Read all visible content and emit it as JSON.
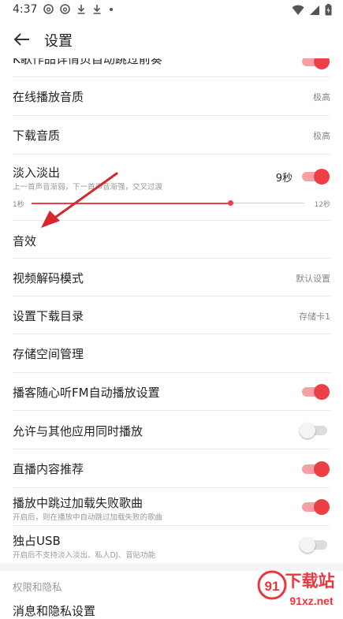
{
  "status": {
    "time": "4:37"
  },
  "header": {
    "title": "设置"
  },
  "rows": {
    "skip_preview": {
      "label": "K歌作品详情页自动跳过前奏"
    },
    "online_quality": {
      "label": "在线播放音质",
      "value": "极高"
    },
    "download_quality": {
      "label": "下载音质",
      "value": "极高"
    },
    "fade": {
      "label": "淡入淡出",
      "subtitle": "上一首声音渐弱，下一首声音渐强，交叉过渡",
      "value": "9秒",
      "slider_min": "1秒",
      "slider_max": "12秒",
      "slider_value": 9
    },
    "sound_effect": {
      "label": "音效"
    },
    "video_decode": {
      "label": "视频解码模式",
      "value": "默认设置"
    },
    "download_dir": {
      "label": "设置下载目录",
      "value": "存储卡1"
    },
    "storage": {
      "label": "存储空间管理"
    },
    "podcast_fm": {
      "label": "播客随心听FM自动播放设置"
    },
    "other_apps": {
      "label": "允许与其他应用同时播放"
    },
    "live_recommend": {
      "label": "直播内容推荐"
    },
    "skip_failed": {
      "label": "播放中跳过加载失败歌曲",
      "subtitle": "开启后，则在播放中自动跳过加载失败的歌曲"
    },
    "usb": {
      "label": "独占USB",
      "subtitle": "开启后不支持淡入淡出、私人DJ、音贴功能"
    }
  },
  "section": {
    "title": "权限和隐私",
    "cut_row": "消息和隐私设置"
  },
  "toggles": {
    "skip_preview": true,
    "fade": true,
    "podcast_fm": true,
    "other_apps": false,
    "live_recommend": true,
    "skip_failed": true,
    "usb": false
  },
  "colors": {
    "accent": "#ec3f46",
    "annotation_arrow": "#d9262c"
  },
  "watermark": {
    "brand": "下载站",
    "domain": "91xz.net"
  }
}
